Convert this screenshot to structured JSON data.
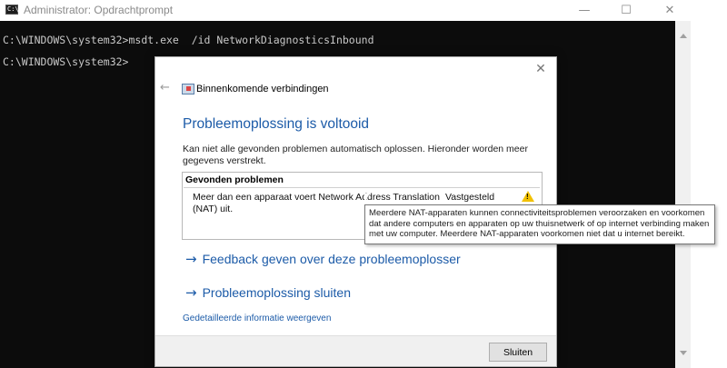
{
  "console": {
    "title": "Administrator: Opdrachtprompt",
    "lines": [
      "C:\\WINDOWS\\system32>msdt.exe  /id NetworkDiagnosticsInbound",
      "C:\\WINDOWS\\system32>"
    ],
    "icon_text": "C:\\",
    "controls": {
      "minimize": "—",
      "maximize": "☐",
      "close": "✕"
    }
  },
  "dialog": {
    "header": "Binnenkomende verbindingen",
    "heading": "Probleemoplossing is voltooid",
    "description": "Kan niet alle gevonden problemen automatisch oplossen. Hieronder worden meer gegevens verstrekt.",
    "problems": {
      "header": "Gevonden problemen",
      "items": [
        {
          "text": "Meer dan een apparaat voert Network Address Translation (NAT) uit.",
          "status": "Vastgesteld",
          "icon": "warning-icon"
        }
      ]
    },
    "links": {
      "feedback": "Feedback geven over deze probleemoplosser",
      "close_troubleshoot": "Probleemoplossing sluiten",
      "details": "Gedetailleerde informatie weergeven"
    },
    "close_button": "Sluiten",
    "arrow_glyph": "→"
  },
  "tooltip": {
    "text": "Meerdere NAT-apparaten kunnen connectiviteitsproblemen veroorzaken en voorkomen dat andere computers en apparaten op uw thuisnetwerk of op internet verbinding maken met uw computer. Meerdere NAT-apparaten voorkomen niet dat u internet bereikt."
  },
  "colors": {
    "console_bg": "#0c0c0c",
    "console_text": "#c8c8c8",
    "link_blue": "#1c5ba8",
    "warning_yellow": "#f2c100"
  }
}
